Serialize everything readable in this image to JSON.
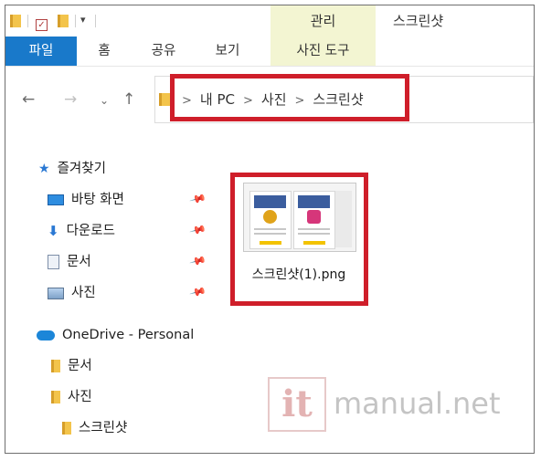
{
  "titlebar": {
    "manage_tab": "관리",
    "window_title": "스크린샷"
  },
  "ribbon": {
    "tabs": [
      {
        "label": "파일"
      },
      {
        "label": "홈"
      },
      {
        "label": "공유"
      },
      {
        "label": "보기"
      },
      {
        "label": "사진 도구"
      }
    ]
  },
  "navigation": {
    "back_icon": "back-arrow",
    "forward_icon": "forward-arrow",
    "history_icon": "chevron-down",
    "up_icon": "up-arrow"
  },
  "address_bar": {
    "crumbs": [
      "내 PC",
      "사진",
      "스크린샷"
    ]
  },
  "nav_pane": {
    "quick_access": "즐겨찾기",
    "pinned": [
      {
        "label": "바탕 화면",
        "icon": "desktop-icon"
      },
      {
        "label": "다운로드",
        "icon": "download-icon"
      },
      {
        "label": "문서",
        "icon": "document-icon"
      },
      {
        "label": "사진",
        "icon": "pictures-icon"
      }
    ],
    "onedrive": "OneDrive - Personal",
    "onedrive_children": [
      {
        "label": "문서"
      },
      {
        "label": "사진"
      },
      {
        "label": "스크린샷"
      }
    ]
  },
  "content": {
    "file_name": "스크린샷(1).png"
  },
  "watermark": {
    "mark": "it",
    "text": "manual.net"
  },
  "colors": {
    "file_tab": "#1979ca",
    "tool_tab": "#f3f5d2",
    "highlight": "#cf1e2a",
    "folder": "#f3c44b"
  }
}
